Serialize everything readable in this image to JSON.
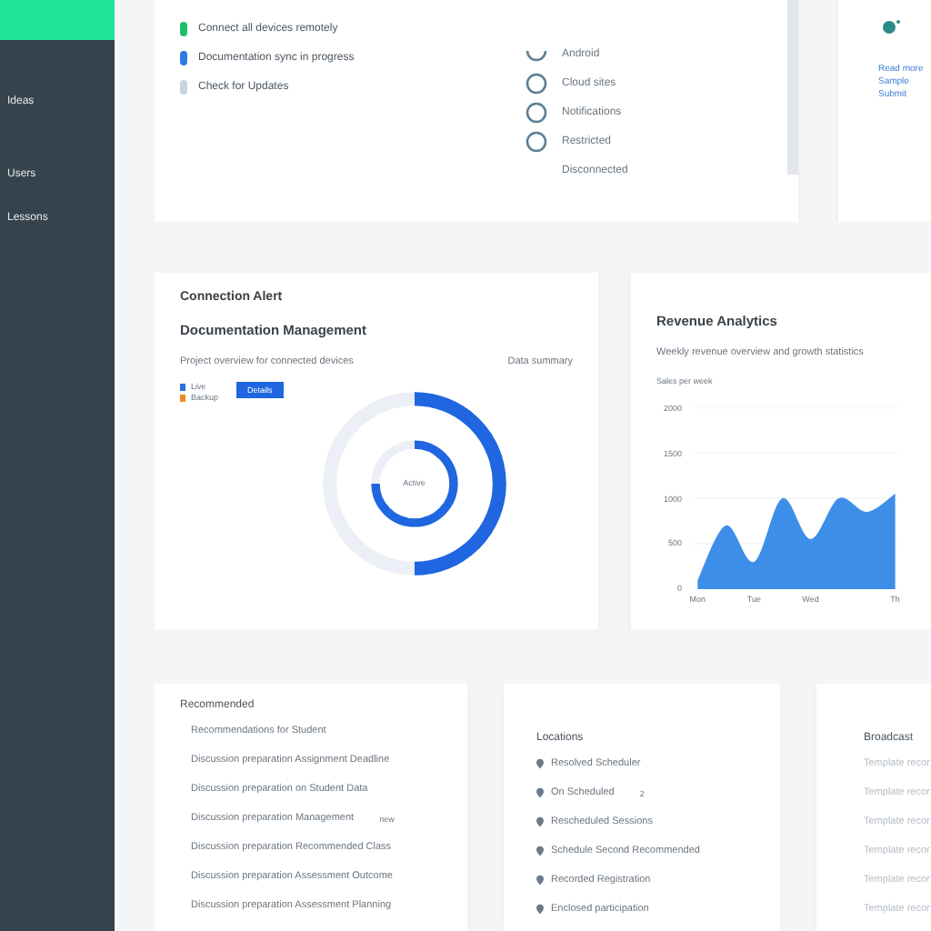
{
  "sidebar": {
    "items": [
      {
        "label": "Ideas"
      },
      {
        "label": "Users"
      },
      {
        "label": "Lessons"
      }
    ]
  },
  "status_card": {
    "items": [
      {
        "label": "Connect all devices remotely",
        "color": "#1fbf6a"
      },
      {
        "label": "Documentation sync in progress",
        "color": "#2a7be4"
      },
      {
        "label": "Check for Updates",
        "color": "#c9d3dc"
      }
    ],
    "options": [
      {
        "label": "Android",
        "kind": "half"
      },
      {
        "label": "Cloud sites",
        "kind": "ring"
      },
      {
        "label": "Notifications",
        "kind": "ring"
      },
      {
        "label": "Restricted",
        "kind": "ring"
      },
      {
        "label": "Disconnected",
        "kind": "none"
      }
    ]
  },
  "side_card": {
    "links": [
      "Read more",
      "Sample",
      "Submit"
    ]
  },
  "donut_card": {
    "title": "Connection Alert",
    "subtitle": "Documentation Management",
    "caption": "Project overview for connected devices",
    "caption_right": "Data summary",
    "legend": [
      {
        "label": "Live",
        "color": "#2a6fdb"
      },
      {
        "label": "Backup",
        "color": "#f08a24"
      }
    ],
    "button": "Details",
    "outer": {
      "level": 0.5
    },
    "center": "Active"
  },
  "chart_card": {
    "title": "Revenue Analytics",
    "subtitle": "Weekly revenue overview and growth statistics",
    "chart_data": {
      "type": "area",
      "ylabel": "Sales per week",
      "categories": [
        "Mon",
        null,
        "Tue",
        null,
        "Wed",
        null,
        null,
        "Th"
      ],
      "series": [
        {
          "color": "#3d8ee8",
          "values": [
            100,
            700,
            300,
            1000,
            550,
            1000,
            850,
            1050
          ]
        }
      ],
      "grid": true,
      "ylim": [
        0,
        2000
      ],
      "yticks": [
        0,
        500,
        1000,
        1500,
        2000
      ]
    }
  },
  "tasks_card": {
    "title": "Recommended",
    "rows": [
      {
        "label": "Recommendations for Student"
      },
      {
        "label": "Discussion preparation Assignment Deadline"
      },
      {
        "label": "Discussion preparation on Student Data"
      },
      {
        "label": "Discussion preparation Management",
        "tag": "new"
      },
      {
        "label": "Discussion preparation Recommended Class"
      },
      {
        "label": "Discussion preparation Assessment Outcome"
      },
      {
        "label": "Discussion preparation Assessment Planning"
      }
    ]
  },
  "places_card": {
    "title": "Locations",
    "rows": [
      {
        "label": "Resolved Scheduler"
      },
      {
        "label": "On Scheduled",
        "tag": "2"
      },
      {
        "label": "Rescheduled Sessions"
      },
      {
        "label": "Schedule Second Recommended"
      },
      {
        "label": "Recorded Registration"
      },
      {
        "label": "Enclosed participation"
      }
    ]
  },
  "notes_card": {
    "title": "Broadcast",
    "rows": [
      "Template recor",
      "Template recor",
      "Template recor",
      "Template recor",
      "Template recor",
      "Template recor"
    ]
  }
}
